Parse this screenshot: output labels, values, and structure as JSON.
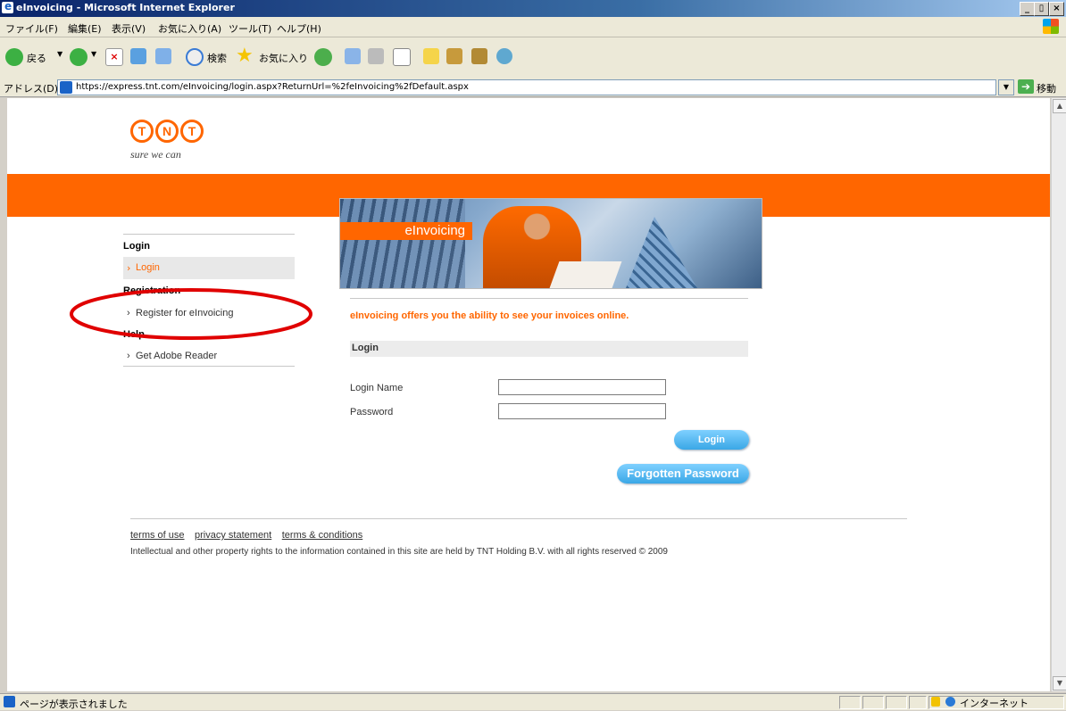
{
  "window": {
    "title": "eInvoicing - Microsoft Internet Explorer",
    "buttons": [
      "_",
      "▯",
      "×"
    ]
  },
  "menu": [
    "ファイル(F)",
    "編集(E)",
    "表示(V)",
    "お気に入り(A)",
    "ツール(T)",
    "ヘルプ(H)"
  ],
  "toolbar": {
    "back_label": "戻る",
    "search_label": "検索",
    "favorites_label": "お気に入り"
  },
  "address": {
    "label": "アドレス(D)",
    "url": "https://express.tnt.com/eInvoicing/login.aspx?ReturnUrl=%2feInvoicing%2fDefault.aspx",
    "go_label": "移動"
  },
  "logo": {
    "letters": [
      "T",
      "N",
      "T"
    ],
    "tagline": "sure we can"
  },
  "banner": {
    "title": "eInvoicing"
  },
  "sidebar": {
    "sections": [
      {
        "heading": "Login",
        "links": [
          "Login"
        ]
      },
      {
        "heading": "Registration",
        "links": [
          "Register for eInvoicing"
        ]
      },
      {
        "heading": "Help",
        "links": [
          "Get Adobe Reader"
        ]
      }
    ]
  },
  "main": {
    "intro": "eInvoicing offers you the ability to see your invoices online.",
    "section_title": "Login",
    "login_name_label": "Login Name",
    "password_label": "Password",
    "login_name_value": "",
    "password_value": "",
    "login_button": "Login",
    "forgot_button": "Forgotten Password"
  },
  "footer": {
    "links": [
      "terms of use",
      "privacy statement",
      "terms & conditions"
    ],
    "copyright": "Intellectual and other property rights to the information contained in this site are held by TNT Holding B.V. with all rights reserved © 2009"
  },
  "status": {
    "text": "ページが表示されました",
    "zone": "インターネット"
  },
  "colors": {
    "brand_orange": "#ff6600",
    "button_blue": "#3aa7e6",
    "annotation_red": "#e00000"
  }
}
